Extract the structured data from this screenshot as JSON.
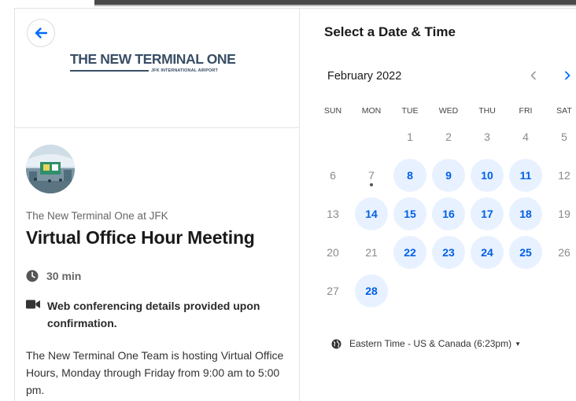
{
  "event": {
    "back_icon": "arrow-left-icon",
    "logo": {
      "title": "THE NEW TERMINAL ONE",
      "subtitle": "JFK INTERNATIONAL AIRPORT"
    },
    "organizer": "The New Terminal One at JFK",
    "title": "Virtual Office Hour Meeting",
    "duration": "30 min",
    "conferencing": "Web conferencing details provided upon confirmation.",
    "description": "The New Terminal One Team is hosting Virtual Office Hours, Monday through Friday from 9:00 am to 5:00 pm."
  },
  "calendar": {
    "heading": "Select a Date & Time",
    "month_label": "February 2022",
    "prev_icon": "chevron-left-icon",
    "next_icon": "chevron-right-icon",
    "weekdays": [
      "SUN",
      "MON",
      "TUE",
      "WED",
      "THU",
      "FRI",
      "SAT"
    ],
    "first_weekday_index": 2,
    "days_in_month": 28,
    "today": 7,
    "available_days": [
      8,
      9,
      10,
      11,
      14,
      15,
      16,
      17,
      18,
      22,
      23,
      24,
      25,
      28
    ],
    "colors": {
      "accent": "#006bff",
      "available_bg": "#e8f1ff"
    }
  },
  "timezone": {
    "label": "Eastern Time - US & Canada (6:23pm)",
    "icon": "globe-icon"
  }
}
